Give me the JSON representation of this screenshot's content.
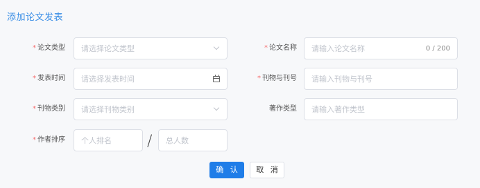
{
  "page": {
    "title": "添加论文发表"
  },
  "form": {
    "paper_type": {
      "label": "论文类型",
      "required": "*",
      "placeholder": "请选择论文类型",
      "icon": "chevron-down-icon"
    },
    "paper_name": {
      "label": "论文名称",
      "required": "*",
      "placeholder": "请输入论文名称",
      "counter": "0 / 200"
    },
    "publish_time": {
      "label": "发表时间",
      "required": "*",
      "placeholder": "请选择发表时间",
      "icon": "calendar-icon"
    },
    "journal_issue": {
      "label": "刊物与刊号",
      "required": "*",
      "placeholder": "请输入刊物与刊号"
    },
    "journal_category": {
      "label": "刊物类别",
      "required": "*",
      "placeholder": "请选择刊物类别",
      "icon": "chevron-down-icon"
    },
    "work_type": {
      "label": "著作类型",
      "placeholder": "请输入著作类型"
    },
    "author_rank": {
      "label": "作者排序",
      "required": "*",
      "personal_placeholder": "个人排名",
      "separator": "/",
      "total_placeholder": "总人数"
    }
  },
  "actions": {
    "confirm": "确 认",
    "cancel": "取 消"
  },
  "colors": {
    "accent": "#1f7de8",
    "title": "#3a8ee6",
    "required": "#f56c6c"
  }
}
